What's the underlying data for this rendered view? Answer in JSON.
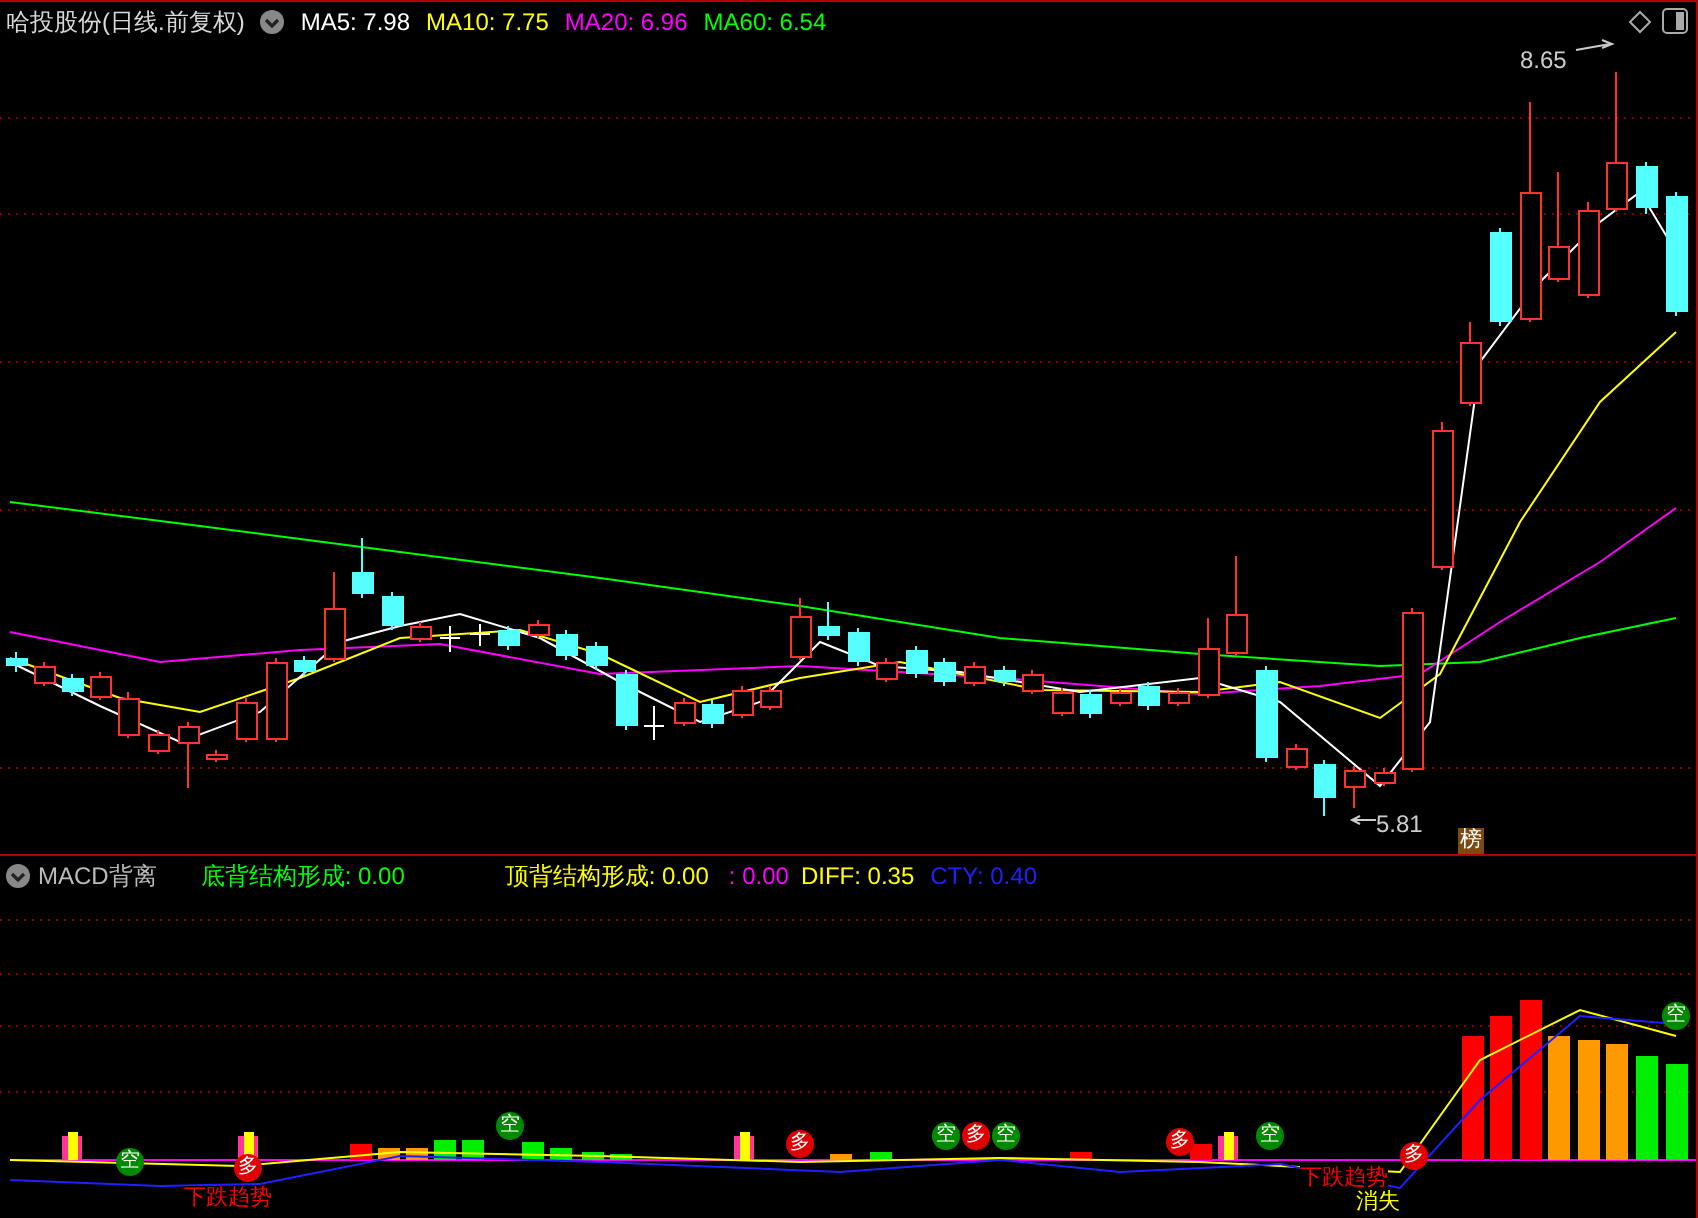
{
  "header": {
    "title": "哈投股份(日线.前复权)",
    "indicators": [
      {
        "label": "MA5: 7.98",
        "color": "#ffffff"
      },
      {
        "label": "MA10: 7.75",
        "color": "#ffff00"
      },
      {
        "label": "MA20: 6.96",
        "color": "#ff00ff"
      },
      {
        "label": "MA60: 6.54",
        "color": "#00ff00"
      }
    ]
  },
  "price_chart": {
    "high_label": "8.65",
    "low_label": "5.81",
    "badge": "榜"
  },
  "indicator_panel": {
    "title": "MACD背离",
    "readings": [
      {
        "label": "底背结构形成: 0.00",
        "color": "#00ff00"
      },
      {
        "label": "顶背结构形成: 0.00",
        "color": "#ffff00"
      },
      {
        "label": ": 0.00",
        "color": "#ff00ff"
      },
      {
        "label": "DIFF: 0.35",
        "color": "#ffff00"
      },
      {
        "label": "CTY: 0.40",
        "color": "#2020ff"
      }
    ],
    "signals": [
      {
        "text": "空",
        "color": "#008a00"
      },
      {
        "text": "多",
        "color": "#e00000"
      },
      {
        "text": "空",
        "color": "#008a00"
      },
      {
        "text": "多",
        "color": "#e00000"
      },
      {
        "text": "空",
        "color": "#008a00"
      },
      {
        "text": "多",
        "color": "#e00000"
      },
      {
        "text": "空",
        "color": "#008a00"
      },
      {
        "text": "多",
        "color": "#e00000"
      },
      {
        "text": "空",
        "color": "#008a00"
      },
      {
        "text": "多",
        "color": "#e00000"
      },
      {
        "text": "空",
        "color": "#008a00"
      }
    ],
    "notes": [
      {
        "text": "下跌趋势",
        "color": "#ff0000"
      },
      {
        "text": "下跌趋势",
        "color": "#ff0000"
      },
      {
        "text": "消失",
        "color": "#ffff00"
      }
    ]
  }
}
